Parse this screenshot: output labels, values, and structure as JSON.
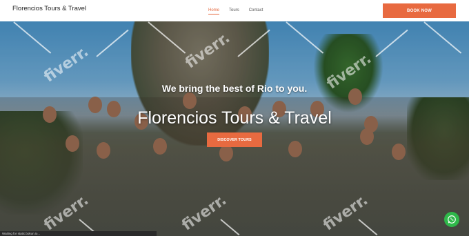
{
  "header": {
    "brand": "Florencios Tours & Travel",
    "nav": [
      {
        "label": "Home",
        "active": true
      },
      {
        "label": "Tours",
        "active": false
      },
      {
        "label": "Contact",
        "active": false
      }
    ],
    "book_label": "BOOK NOW"
  },
  "hero": {
    "tagline": "We bring the best of Rio to you.",
    "title": "Florencios Tours & Travel",
    "cta_label": "DISCOVER TOURS"
  },
  "watermark": {
    "text": "fiverr."
  },
  "status_bar": {
    "text": "Waiting for static.bokun.io..."
  },
  "colors": {
    "accent": "#e86a40",
    "whatsapp": "#2fb84a"
  },
  "icons": [
    "whatsapp-icon"
  ]
}
